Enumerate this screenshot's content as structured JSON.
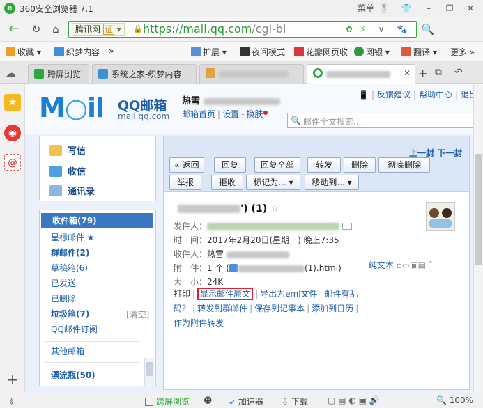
{
  "window": {
    "title": "360安全浏览器 7.1",
    "menu_label": "菜单",
    "minimize": "–",
    "restore": "❐",
    "close": "✕"
  },
  "address": {
    "tx_label": "腾讯网",
    "cert_label": "证",
    "url_main": "https://mail.qq.com",
    "url_rest": "/cgi-bi"
  },
  "bookmarks": [
    {
      "label": "收藏 ▾",
      "icon": "star-icon",
      "color": "#f0a020"
    },
    {
      "label": "织梦内容",
      "icon": "dede-icon",
      "color": "#3d8fd6"
    },
    {
      "label": "»",
      "icon": "",
      "color": ""
    },
    {
      "label": "扩展 ▾",
      "icon": "grid-icon",
      "color": "#5b8fd9"
    },
    {
      "label": "夜间模式",
      "icon": "moon-icon",
      "color": "#333333"
    },
    {
      "label": "花瓣网页收",
      "icon": "huaban-icon",
      "color": "#d9363e"
    },
    {
      "label": "网银 ▾",
      "icon": "bank-icon",
      "color": "#2b9a3f"
    },
    {
      "label": "翻译 ▾",
      "icon": "translate-icon",
      "color": "#e05a3a"
    },
    {
      "label": "更多 »",
      "icon": "",
      "color": ""
    }
  ],
  "tabs": [
    {
      "label": "跨屏浏览",
      "active": false
    },
    {
      "label": "系统之家-织梦内容",
      "active": false
    },
    {
      "label": "",
      "active": false
    },
    {
      "label": "",
      "active": true
    }
  ],
  "mail_header": {
    "logo_text": "QQ邮箱",
    "logo_sub": "mail.qq.com",
    "user_name": "热雪",
    "home": "邮箱首页",
    "settings": "设置",
    "skin": "换肤",
    "top_links": [
      "反馈建议",
      "帮助中心",
      "退出"
    ],
    "search_placeholder": "邮件全文搜索..."
  },
  "compose": {
    "write": "写信",
    "receive": "收信",
    "contacts": "通讯录"
  },
  "folders": [
    {
      "label": "收件箱(79)",
      "active": true,
      "bold": true
    },
    {
      "label": "星标邮件 ★",
      "active": false,
      "bold": false
    },
    {
      "label": "群邮件(2)",
      "active": false,
      "bold": true
    },
    {
      "label": "草稿箱(6)",
      "active": false,
      "bold": false
    },
    {
      "label": "已发送",
      "active": false,
      "bold": false
    },
    {
      "label": "已删除",
      "active": false,
      "bold": false
    },
    {
      "label": "垃圾箱(7)",
      "active": false,
      "bold": true
    },
    {
      "label": "QQ邮件订阅",
      "active": false,
      "bold": false
    },
    {
      "label": "其他邮箱",
      "active": false,
      "bold": false
    },
    {
      "label": "漂流瓶(50)",
      "active": false,
      "bold": true
    }
  ],
  "folder_clear": "[清空]",
  "pager": {
    "prev": "上一封",
    "next": "下一封"
  },
  "toolbar_row1": [
    "« 返回",
    "回复",
    "回复全部",
    "转发",
    "删除",
    "彻底删除"
  ],
  "toolbar_row2": [
    "举报",
    "拒收",
    "标记为... ▾",
    "移动到... ▾"
  ],
  "message": {
    "subject_tail": "') (1)",
    "sender_label": "发件人：",
    "time_label": "时　间：",
    "time_value": "2017年2月20日(星期一) 晚上7:35",
    "recipient_label": "收件人：",
    "recipient_value": "热雪",
    "attach_label": "附　件：",
    "attach_count": "1 个 (",
    "attach_file": "(1).html)",
    "plain_text": "纯文本",
    "size_label": "大　小：",
    "size_value": "24K",
    "ops": {
      "print": "打印",
      "show_original": "显示邮件原文",
      "export_eml": "导出为eml文件",
      "garbled": "邮件有乱码？",
      "forward_group": "转发到群邮件",
      "save_note": "保存到记事本",
      "add_calendar": "添加到日历",
      "forward_attach": "作为附件转发"
    }
  },
  "statusbar": {
    "cross_screen": "跨屏浏览",
    "accelerator": "加速器",
    "download": "下载",
    "zoom": "100%"
  },
  "colors": {
    "accent_green": "#3aa34a",
    "mail_blue": "#1f5fab",
    "folder_active": "#3b78c3",
    "highlight_red": "#d9262c"
  }
}
